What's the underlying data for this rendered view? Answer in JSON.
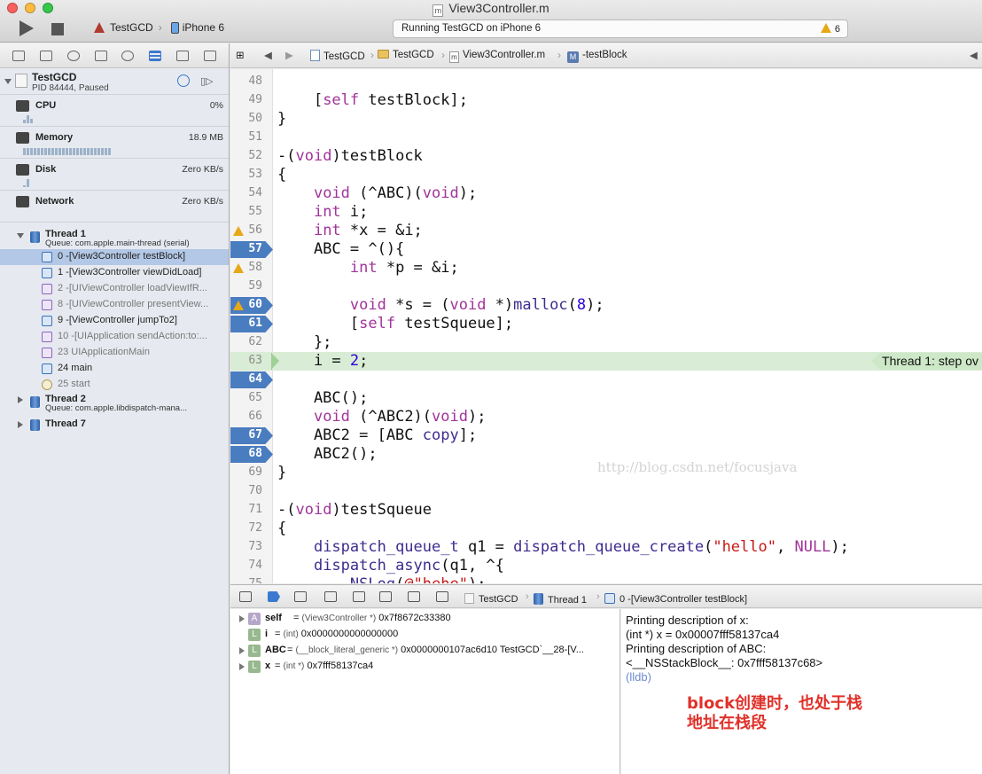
{
  "window": {
    "title": "View3Controller.m",
    "title_icon": "m",
    "scheme": "TestGCD",
    "device": "iPhone 6",
    "activity": "Running TestGCD on iPhone 6",
    "warning_count": "6"
  },
  "navigator": {
    "process_name": "TestGCD",
    "process_status": "PID 84444, Paused",
    "gauges": [
      {
        "label": "CPU",
        "value": "0%",
        "icon": "cpu-icon",
        "bars": [
          4,
          9,
          5
        ]
      },
      {
        "label": "Memory",
        "value": "18.9 MB",
        "icon": "memory-icon",
        "bars": [
          8,
          8,
          8,
          8,
          8,
          8,
          8,
          8,
          8,
          8,
          8,
          8,
          8,
          8,
          8,
          8,
          8,
          8,
          8,
          8,
          8,
          8,
          8,
          8,
          8
        ]
      },
      {
        "label": "Disk",
        "value": "Zero KB/s",
        "icon": "disk-icon",
        "bars": [
          2,
          9
        ]
      },
      {
        "label": "Network",
        "value": "Zero KB/s",
        "icon": "network-icon",
        "bars": []
      }
    ],
    "thread1": {
      "name": "Thread 1",
      "queue": "Queue: com.apple.main-thread (serial)",
      "frames": [
        {
          "label": "0 -[View3Controller testBlock]",
          "kind": "user",
          "selected": true
        },
        {
          "label": "1 -[View3Controller viewDidLoad]",
          "kind": "user"
        },
        {
          "label": "2 -[UIViewController loadViewIfR...",
          "kind": "system"
        },
        {
          "label": "8 -[UIViewController presentView...",
          "kind": "system"
        },
        {
          "label": "9 -[ViewController jumpTo2]",
          "kind": "user"
        },
        {
          "label": "10 -[UIApplication sendAction:to:...",
          "kind": "system"
        },
        {
          "label": "23 UIApplicationMain",
          "kind": "system"
        },
        {
          "label": "24 main",
          "kind": "user"
        },
        {
          "label": "25 start",
          "kind": "gear"
        }
      ]
    },
    "thread2": {
      "name": "Thread 2",
      "queue": "Queue: com.apple.libdispatch-mana..."
    },
    "thread7": {
      "name": "Thread 7"
    }
  },
  "jumpbar": {
    "project": "TestGCD",
    "group": "TestGCD",
    "file": "View3Controller.m",
    "method": "-testBlock"
  },
  "editor": {
    "pc_annotation": "Thread 1: step ov",
    "watermark": "http://blog.csdn.net/focusjava",
    "lines": [
      {
        "no": "48",
        "html": ""
      },
      {
        "no": "49",
        "html": "    [<span class=\"kw\">self</span> testBlock];"
      },
      {
        "no": "50",
        "html": "}"
      },
      {
        "no": "51",
        "html": ""
      },
      {
        "no": "52",
        "html": "-(<span class=\"kw\">void</span>)testBlock"
      },
      {
        "no": "53",
        "html": "{"
      },
      {
        "no": "54",
        "html": "    <span class=\"kw\">void</span> (^ABC)(<span class=\"kw\">void</span>);"
      },
      {
        "no": "55",
        "html": "    <span class=\"kw\">int</span> i;"
      },
      {
        "no": "56",
        "html": "    <span class=\"kw\">int</span> *x = &amp;i;",
        "warn": true
      },
      {
        "no": "57",
        "html": "    ABC = ^(){",
        "bp": true
      },
      {
        "no": "58",
        "html": "        <span class=\"kw\">int</span> *p = &amp;i;",
        "warn": true
      },
      {
        "no": "59",
        "html": ""
      },
      {
        "no": "60",
        "html": "        <span class=\"kw\">void</span> *s = (<span class=\"kw\">void</span> *)<span class=\"fn\">malloc</span>(<span class=\"num\">8</span>);",
        "warn": true,
        "bp": true
      },
      {
        "no": "61",
        "html": "        [<span class=\"kw\">self</span> testSqueue];",
        "bp": true
      },
      {
        "no": "62",
        "html": "    };"
      },
      {
        "no": "63",
        "html": "    i = <span class=\"num\">2</span>;",
        "current": true
      },
      {
        "no": "64",
        "html": "",
        "bp": true
      },
      {
        "no": "65",
        "html": "    ABC();"
      },
      {
        "no": "66",
        "html": "    <span class=\"kw\">void</span> (^ABC2)(<span class=\"kw\">void</span>);"
      },
      {
        "no": "67",
        "html": "    ABC2 = [ABC <span class=\"fn\">copy</span>];",
        "bp": true
      },
      {
        "no": "68",
        "html": "    ABC2();",
        "bp": true
      },
      {
        "no": "69",
        "html": "}"
      },
      {
        "no": "70",
        "html": ""
      },
      {
        "no": "71",
        "html": "-(<span class=\"kw\">void</span>)testSqueue"
      },
      {
        "no": "72",
        "html": "{"
      },
      {
        "no": "73",
        "html": "    <span class=\"fn\">dispatch_queue_t</span> q1 = <span class=\"fn\">dispatch_queue_create</span>(<span class=\"str\">\"hello\"</span>, <span class=\"kw\">NULL</span>);"
      },
      {
        "no": "74",
        "html": "    <span class=\"fn\">dispatch_async</span>(q1, ^{"
      },
      {
        "no": "75",
        "html": "        <span class=\"fn\">NSLog</span>(<span class=\"str\">@\"hehe\"</span>);"
      }
    ]
  },
  "debugbar": {
    "process": "TestGCD",
    "thread": "Thread 1",
    "frame": "0 -[View3Controller testBlock]"
  },
  "variables": [
    {
      "badge": "A",
      "name": "self",
      "type": "(View3Controller *)",
      "value": "0x7f8672c33380",
      "expandable": true
    },
    {
      "badge": "L",
      "name": "i",
      "type": "(int)",
      "value": "0x0000000000000000",
      "expandable": false
    },
    {
      "badge": "L",
      "name": "ABC",
      "type": "(__block_literal_generic *)",
      "value": "0x0000000107ac6d10 TestGCD`__28-[V...",
      "expandable": true
    },
    {
      "badge": "L",
      "name": "x",
      "type": "(int *)",
      "value": "0x7fff58137ca4",
      "expandable": true
    }
  ],
  "console": {
    "lines": [
      "Printing description of x:",
      "(int *) x = 0x00007fff58137ca4",
      "Printing description of ABC:",
      "<__NSStackBlock__: 0x7fff58137c68>"
    ],
    "prompt": "(lldb)",
    "note_line1": "block创建时，也处于栈",
    "note_line2": "地址在栈段"
  }
}
